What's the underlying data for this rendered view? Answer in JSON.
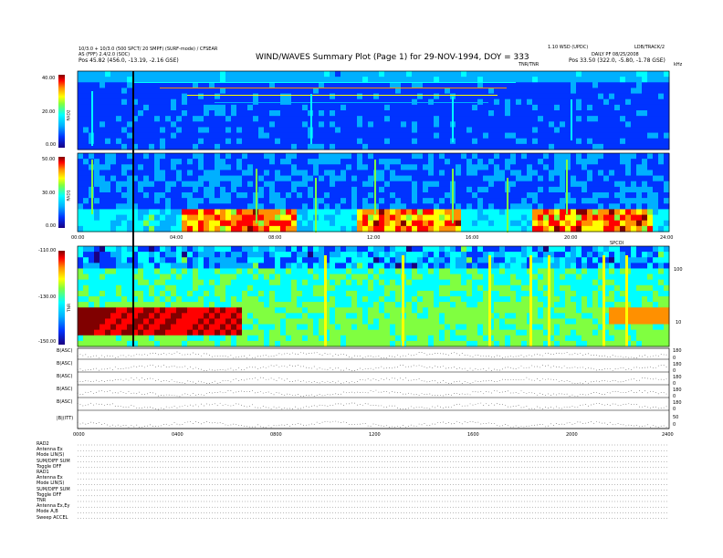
{
  "header": {
    "left_line1": "10/3.0 + 10/3.0 (500 SPCT/ 20 SMPF) (SURF-mode) / CFSEAR",
    "left_line2": "AS (FPF) 2.4/2.0 (SOC)",
    "left_pos": "Pos    45.82 (456.0, -13.19, -2.16 GSE)",
    "title": "WIND/WAVES Summary Plot (Page 1) for 29-NOV-1994, DOY = 333",
    "right_line1": "1.10 WSD (UPDC)",
    "right_line1b": "LDB/TRACK/2",
    "right_line2": "DAILY PF 08/25/2008",
    "right_pos": "Pos    33.50 (322.0, -5.80, -1.78 GSE)",
    "sub_label": "TNR/TNR",
    "units_tr": "kHz"
  },
  "chart_data": [
    {
      "type": "heatmap",
      "name": "RAD2",
      "ytick_labels": [
        "40.00",
        "20.00",
        "0.00"
      ],
      "ylim": [
        0,
        40
      ]
    },
    {
      "type": "heatmap",
      "name": "RAD1",
      "ytick_labels": [
        "50.00",
        "30.00",
        "0.00"
      ],
      "ylim": [
        0,
        50
      ],
      "xtick_labels": [
        "00:00",
        "04:00",
        "08:00",
        "12:00",
        "16:00",
        "20:00",
        "24:00"
      ],
      "x_right_label": "SPCOI"
    },
    {
      "type": "heatmap",
      "name": "TNR",
      "ytick_labels": [
        "-110.00",
        "-130.00",
        "-150.00"
      ],
      "right_tick_labels": [
        "100",
        "10"
      ],
      "ylim": [
        -150,
        -110
      ]
    },
    {
      "type": "line",
      "name": "magnetometer",
      "rows": [
        "B(ASC)",
        "B(ASC)",
        "B(ASC)",
        "B(ASC)",
        "B(ASC)",
        "|B|(ITT)"
      ],
      "right_tick_labels": [
        "180",
        "0",
        "180",
        "0",
        "180",
        "0",
        "180",
        "0",
        "180",
        "0",
        "50",
        "0"
      ],
      "xtick_labels": [
        "0000",
        "0400",
        "0800",
        "1200",
        "1600",
        "2000",
        "2400"
      ]
    }
  ],
  "footer": {
    "left_lines": [
      "RAD2",
      "Antenna     Ex",
      "Mode        LIN(S)",
      "SUM/DIFF    SUM",
      "Toggle      OFF",
      "RAD1",
      "Antenna     Ex",
      "Mode        LIN(S)",
      "SUM/DIFF    SUM",
      "Toggle      OFF",
      "TNR",
      "Antenna     Ex,Ey",
      "Mode        A,B",
      "Sweep       ACCEL"
    ]
  },
  "colors": {
    "scale": [
      "#1a0080",
      "#0033ff",
      "#00b0ff",
      "#00ffff",
      "#80ff40",
      "#ffff00",
      "#ff9000",
      "#ff0000",
      "#800000"
    ]
  }
}
